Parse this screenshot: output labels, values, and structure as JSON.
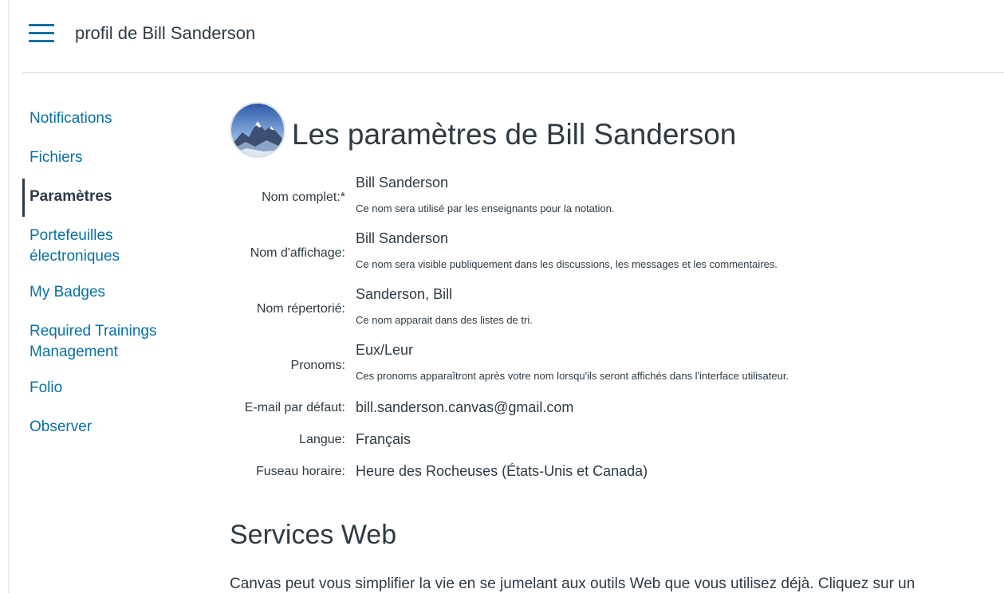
{
  "header": {
    "breadcrumb": "profil de Bill Sanderson"
  },
  "sidebar": {
    "items": [
      {
        "label": "Notifications"
      },
      {
        "label": "Fichiers"
      },
      {
        "label": "Paramètres",
        "active": true
      },
      {
        "label_line1": "Portefeuilles",
        "label_line2": "électroniques"
      },
      {
        "label": "My Badges"
      },
      {
        "label_line1": "Required Trainings",
        "label_line2": "Management"
      },
      {
        "label": "Folio"
      },
      {
        "label": "Observer"
      }
    ]
  },
  "main": {
    "title": "Les paramètres de Bill Sanderson",
    "avatar_icon": "mountain-avatar-icon",
    "settings": {
      "full_name": {
        "label": "Nom complet:*",
        "value": "Bill Sanderson",
        "hint": "Ce nom sera utilisé par les enseignants pour la notation."
      },
      "display_name": {
        "label": "Nom d'affichage:",
        "value": "Bill Sanderson",
        "hint": "Ce nom sera visible publiquement dans les discussions, les messages et les commentaires."
      },
      "sortable_name": {
        "label": "Nom répertorié:",
        "value": "Sanderson, Bill",
        "hint": "Ce nom apparait dans des listes de tri."
      },
      "pronouns": {
        "label": "Pronoms:",
        "value": "Eux/Leur",
        "hint": "Ces pronoms apparaîtront après votre nom lorsqu'ils seront affichés dans l'interface utilisateur."
      },
      "email": {
        "label": "E-mail par défaut:",
        "value": "bill.sanderson.canvas@gmail.com"
      },
      "language": {
        "label": "Langue:",
        "value": "Français"
      },
      "timezone": {
        "label": "Fuseau horaire:",
        "value": "Heure des Rocheuses (États-Unis et Canada)"
      }
    },
    "web_services": {
      "title": "Services Web",
      "text": "Canvas peut vous simplifier la vie en se jumelant aux outils Web que vous utilisez déjà. Cliquez sur un"
    }
  },
  "colors": {
    "link": "#0770a3",
    "text": "#2d3b45",
    "divider": "#e4e7ea"
  }
}
